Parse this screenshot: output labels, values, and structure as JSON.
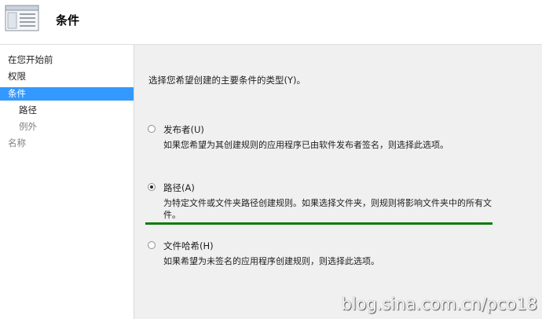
{
  "header": {
    "title": "条件",
    "icon": "window-list-icon"
  },
  "sidebar": {
    "items": [
      {
        "label": "在您开始前",
        "state": "normal",
        "level": 0
      },
      {
        "label": "权限",
        "state": "normal",
        "level": 0
      },
      {
        "label": "条件",
        "state": "selected",
        "level": 0
      },
      {
        "label": "路径",
        "state": "normal",
        "level": 1
      },
      {
        "label": "例外",
        "state": "disabled",
        "level": 1
      },
      {
        "label": "名称",
        "state": "disabled",
        "level": 0
      }
    ]
  },
  "main": {
    "prompt": "选择您希望创建的主要条件的类型(Y)。",
    "options": [
      {
        "label": "发布者(U)",
        "checked": false,
        "description": "如果您希望为其创建规则的应用程序已由软件发布者签名，则选择此选项。"
      },
      {
        "label": "路径(A)",
        "checked": true,
        "description": "为特定文件或文件夹路径创建规则。如果选择文件夹，则规则将影响文件夹中的所有文件。"
      },
      {
        "label": "文件哈希(H)",
        "checked": false,
        "description": "如果希望为未签名的应用程序创建规则，则选择此选项。"
      }
    ]
  },
  "watermark": "blog.sina.com.cn/pco18",
  "colors": {
    "selection": "#3399ff",
    "underline": "#0b7a0b",
    "disabled_text": "#808080"
  }
}
